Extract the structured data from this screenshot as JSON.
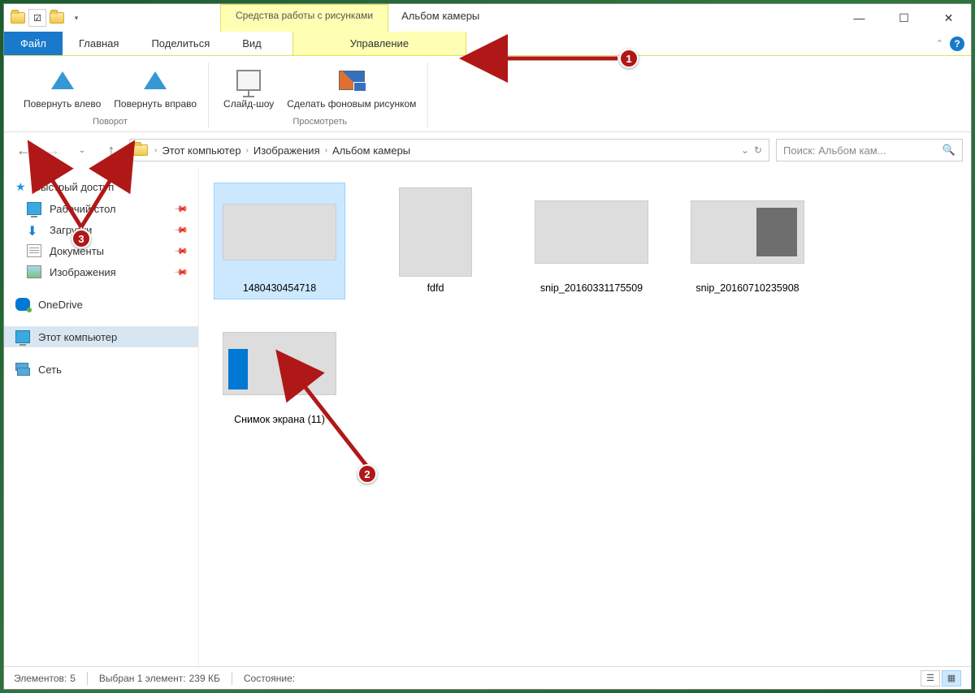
{
  "titlebar": {
    "contextual_tab_title": "Средства работы с рисунками",
    "window_title": "Альбом камеры"
  },
  "tabs": {
    "file": "Файл",
    "home": "Главная",
    "share": "Поделиться",
    "view": "Вид",
    "manage": "Управление"
  },
  "ribbon": {
    "rotate_left": "Повернуть влево",
    "rotate_right": "Повернуть вправо",
    "slideshow": "Слайд-шоу",
    "set_wallpaper": "Сделать фоновым рисунком",
    "group_rotate": "Поворот",
    "group_view": "Просмотреть"
  },
  "breadcrumb": {
    "items": [
      "Этот компьютер",
      "Изображения",
      "Альбом камеры"
    ]
  },
  "search": {
    "placeholder": "Поиск: Альбом кам..."
  },
  "sidebar": {
    "quick_access": "Быстрый доступ",
    "desktop": "Рабочий стол",
    "downloads": "Загрузки",
    "documents": "Документы",
    "pictures": "Изображения",
    "onedrive": "OneDrive",
    "this_pc": "Этот компьютер",
    "network": "Сеть"
  },
  "files": [
    {
      "name": "1480430454718"
    },
    {
      "name": "fdfd"
    },
    {
      "name": "snip_20160331175509"
    },
    {
      "name": "snip_20160710235908"
    },
    {
      "name": "Снимок экрана (11)"
    }
  ],
  "status": {
    "items_label": "Элементов:",
    "items_count": "5",
    "selected_label": "Выбран 1 элемент:",
    "selected_size": "239 КБ",
    "state_label": "Состояние:"
  },
  "annotations": {
    "one": "1",
    "two": "2",
    "three": "3"
  }
}
